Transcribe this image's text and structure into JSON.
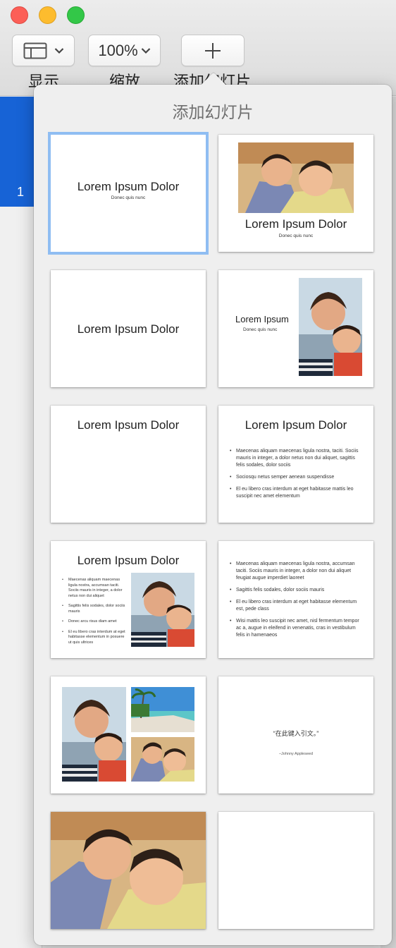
{
  "toolbar": {
    "view_label": "显示",
    "zoom_value": "100%",
    "zoom_label": "缩放",
    "add_label": "添加幻灯片"
  },
  "navigator": {
    "selected_slide_number": "1"
  },
  "popover": {
    "title": "添加幻灯片"
  },
  "layouts": {
    "title_center": {
      "title": "Lorem Ipsum Dolor",
      "subtitle": "Donec quis nunc"
    },
    "title_photo": {
      "title": "Lorem Ipsum Dolor",
      "subtitle": "Donec quis nunc"
    },
    "title_only": {
      "title": "Lorem Ipsum Dolor"
    },
    "title_left_photo": {
      "title": "Lorem Ipsum",
      "subtitle": "Donec quis nunc"
    },
    "title_top": {
      "title": "Lorem Ipsum Dolor"
    },
    "title_bullets": {
      "title": "Lorem Ipsum Dolor",
      "bullets": [
        "Maecenas aliquam maecenas ligula nostra, taciti. Sociis mauris in integer, a dolor netus non dui aliquet, sagittis felis sodales, dolor sociis",
        "Sociosqu netus semper aenean suspendisse",
        "El eu libero cras interdum at eget habitasse mattis leo suscipit nec amet elementum"
      ]
    },
    "title_bullets_photo": {
      "title": "Lorem Ipsum Dolor",
      "bullets": [
        "Maecenas aliquam maecenas ligula nostra, accumsan taciti. Sociis mauris in integer, a dolor netus non dui aliquet",
        "Sagittis felis sodales, dolor sociis mauris",
        "Donec arcu risus diam amet",
        "El eu libero cras interdum at eget habitasse elementum in posuere ut quis ultrices"
      ]
    },
    "bullets_only": {
      "bullets": [
        "Maecenas aliquam maecenas ligula nostra, accumsan taciti. Sociis mauris in integer, a dolor non dui aliquet feugiat augue imperdiet laoreet",
        "Sagittis felis sodales, dolor sociis mauris",
        "El eu libero cras interdum at eget habitasse elementum est, pede class",
        "Wisi mattis leo suscipit nec amet, nisl fermentum tempor ac a, augue in eleifend in venenatis, cras in vestibulum felis in hamenaeos"
      ]
    },
    "quote": {
      "text": "“在此键入引文。”",
      "attribution": "–Johnny Appleseed"
    }
  },
  "colors": {
    "accent_blue": "#1763d6",
    "selection_ring": "#8fbdf2",
    "popover_bg": "#efefef"
  }
}
